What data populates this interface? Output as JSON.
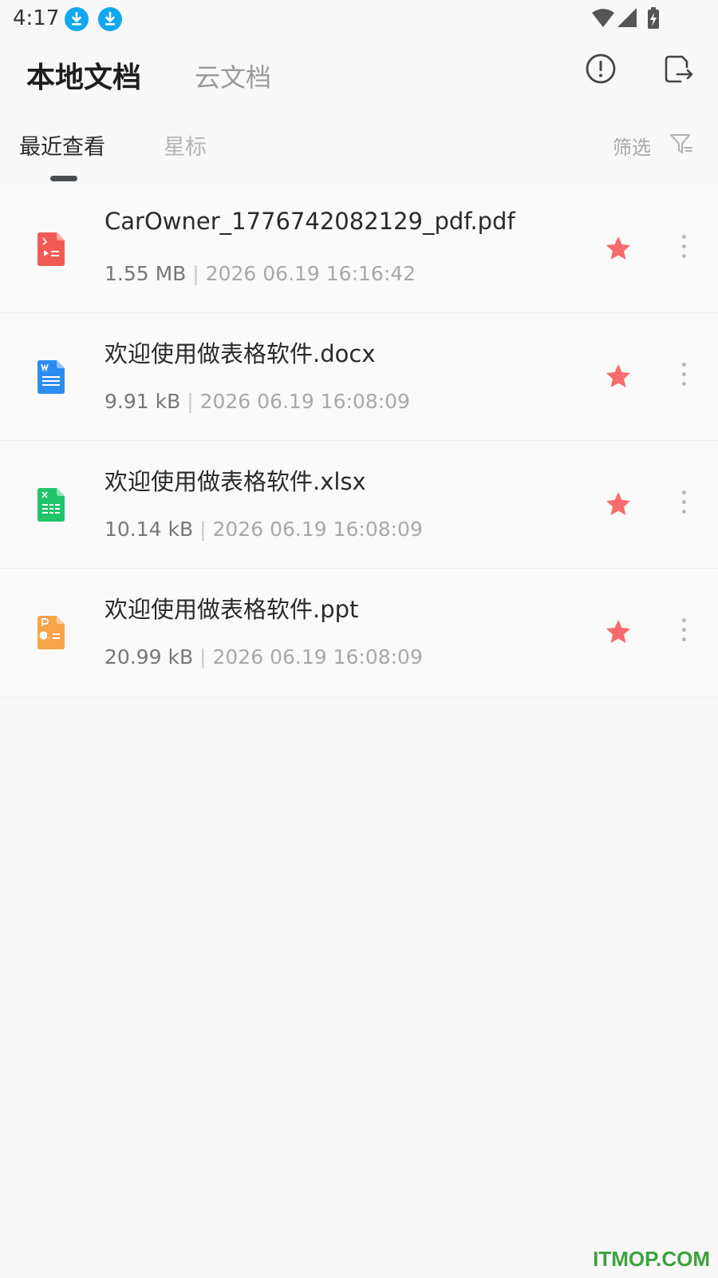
{
  "status_bar": {
    "time": "4:17",
    "notification_icons": [
      "download-icon",
      "download-icon"
    ],
    "system_icons": [
      "wifi-icon",
      "cell-signal-icon",
      "battery-charging-icon"
    ]
  },
  "header": {
    "tab_local": "本地文档",
    "tab_cloud": "云文档",
    "icons": [
      "info-icon",
      "export-document-icon"
    ]
  },
  "subtabs": {
    "recent": "最近查看",
    "starred": "星标",
    "filter_label": "筛选"
  },
  "files": [
    {
      "name": "CarOwner_1776742082129_pdf.pdf",
      "size": "1.55 MB",
      "separator": "|",
      "date": "2026 06.19 16:16:42",
      "type": "pdf",
      "icon": "pdf-file-icon",
      "starred": true
    },
    {
      "name": "欢迎使用做表格软件.docx",
      "size": "9.91 kB",
      "separator": "|",
      "date": "2026 06.19 16:08:09",
      "type": "docx",
      "icon": "word-file-icon",
      "starred": true
    },
    {
      "name": "欢迎使用做表格软件.xlsx",
      "size": "10.14 kB",
      "separator": "|",
      "date": "2026 06.19 16:08:09",
      "type": "xlsx",
      "icon": "excel-file-icon",
      "starred": true
    },
    {
      "name": "欢迎使用做表格软件.ppt",
      "size": "20.99 kB",
      "separator": "|",
      "date": "2026 06.19 16:08:09",
      "type": "ppt",
      "icon": "ppt-file-icon",
      "starred": true
    }
  ],
  "colors": {
    "accent_blue": "#11a8ee",
    "star": "#f96a6d",
    "pdf": "#f15a54",
    "docx": "#2d8cf0",
    "xlsx": "#21c46b",
    "ppt": "#f9a349",
    "watermark": "#3aa33a"
  },
  "watermark": "ITMOP.COM"
}
